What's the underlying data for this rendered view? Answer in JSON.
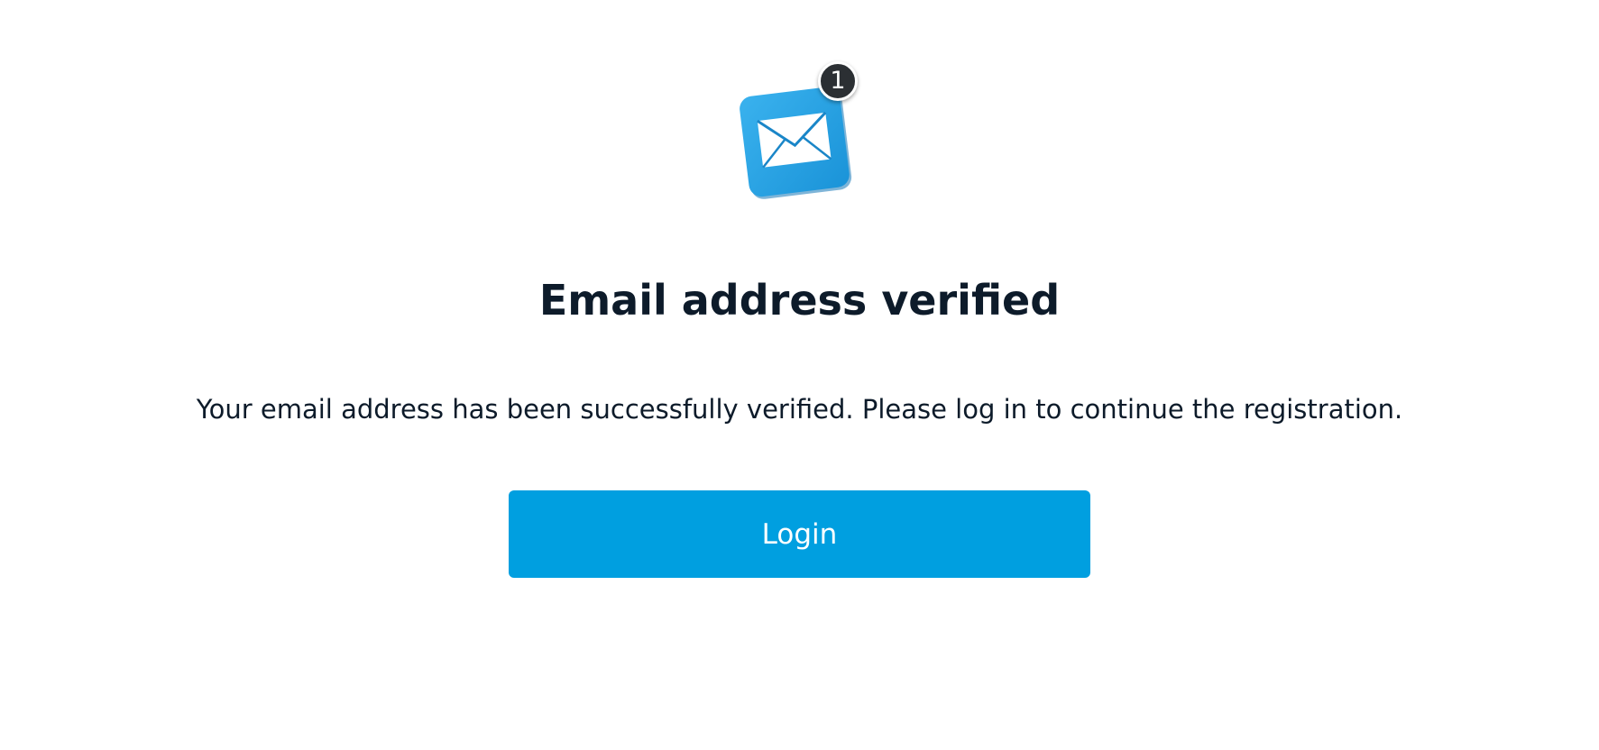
{
  "icon": {
    "name": "mail-icon",
    "badge_count": "1",
    "color": "#1fa3e6"
  },
  "title": "Email address verified",
  "message": "Your email address has been successfully verified. Please log in to continue the registration.",
  "login_button": {
    "label": "Login",
    "color": "#009fe0"
  },
  "colors": {
    "text": "#0d1b2a",
    "background": "#ffffff",
    "badge": "#2b2f33"
  }
}
